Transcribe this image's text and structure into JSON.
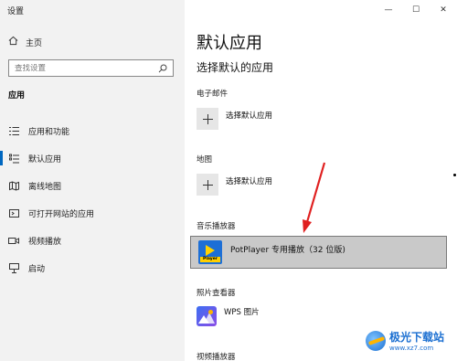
{
  "window": {
    "title": "设置",
    "controls": {
      "minimize": "—",
      "maximize": "☐",
      "close": "✕"
    }
  },
  "sidebar": {
    "home_label": "主页",
    "search_placeholder": "查找设置",
    "section_title": "应用",
    "items": [
      {
        "label": "应用和功能",
        "icon": "apps-list-icon",
        "active": false
      },
      {
        "label": "默认应用",
        "icon": "default-apps-icon",
        "active": true
      },
      {
        "label": "离线地图",
        "icon": "offline-map-icon",
        "active": false
      },
      {
        "label": "可打开网站的应用",
        "icon": "web-apps-icon",
        "active": false
      },
      {
        "label": "视频播放",
        "icon": "video-playback-icon",
        "active": false
      },
      {
        "label": "启动",
        "icon": "startup-icon",
        "active": false
      }
    ]
  },
  "main": {
    "title": "默认应用",
    "subtitle": "选择默认的应用",
    "categories": [
      {
        "name": "电子邮件",
        "app": "选择默认应用"
      },
      {
        "name": "地图",
        "app": "选择默认应用"
      },
      {
        "name": "音乐播放器",
        "app": "PotPlayer 专用播放（32 位版)"
      },
      {
        "name": "照片查看器",
        "app": "WPS 图片"
      },
      {
        "name": "视频播放器",
        "app": ""
      }
    ],
    "potplayer_icon_text": "Player"
  },
  "watermark": {
    "name": "极光下载站",
    "url": "www.xz7.com"
  },
  "colors": {
    "accent": "#0067c0",
    "arrow": "#e02020",
    "sidebar_bg": "#f2f2f2",
    "selected_row": "#c9c9c9"
  }
}
